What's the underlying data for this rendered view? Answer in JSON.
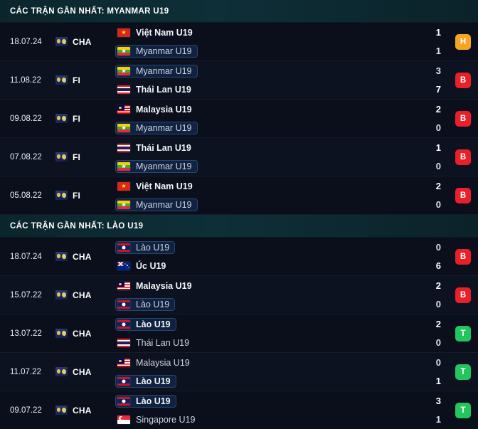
{
  "sections": [
    {
      "title": "CÁC TRẬN GẦN NHẤT: MYANMAR U19",
      "matches": [
        {
          "date": "18.07.24",
          "competition": "CHA",
          "competition_icon": "world-cup-qualifier-icon",
          "home": {
            "name": "Việt Nam U19",
            "flag": "vn",
            "score": "1",
            "bold": true,
            "highlight": false
          },
          "away": {
            "name": "Myanmar U19",
            "flag": "mm",
            "score": "1",
            "bold": false,
            "highlight": true
          },
          "result": {
            "label": "H",
            "color": "#f5a524"
          }
        },
        {
          "date": "11.08.22",
          "competition": "FI",
          "competition_icon": "world-cup-qualifier-icon",
          "home": {
            "name": "Myanmar U19",
            "flag": "mm",
            "score": "3",
            "bold": false,
            "highlight": true
          },
          "away": {
            "name": "Thái Lan U19",
            "flag": "th",
            "score": "7",
            "bold": true,
            "highlight": false
          },
          "result": {
            "label": "B",
            "color": "#e8202a"
          }
        },
        {
          "date": "09.08.22",
          "competition": "FI",
          "competition_icon": "world-cup-qualifier-icon",
          "home": {
            "name": "Malaysia U19",
            "flag": "my",
            "score": "2",
            "bold": true,
            "highlight": false
          },
          "away": {
            "name": "Myanmar U19",
            "flag": "mm",
            "score": "0",
            "bold": false,
            "highlight": true
          },
          "result": {
            "label": "B",
            "color": "#e8202a"
          }
        },
        {
          "date": "07.08.22",
          "competition": "FI",
          "competition_icon": "world-cup-qualifier-icon",
          "home": {
            "name": "Thái Lan U19",
            "flag": "th",
            "score": "1",
            "bold": true,
            "highlight": false
          },
          "away": {
            "name": "Myanmar U19",
            "flag": "mm",
            "score": "0",
            "bold": false,
            "highlight": true
          },
          "result": {
            "label": "B",
            "color": "#e8202a"
          }
        },
        {
          "date": "05.08.22",
          "competition": "FI",
          "competition_icon": "world-cup-qualifier-icon",
          "home": {
            "name": "Việt Nam U19",
            "flag": "vn",
            "score": "2",
            "bold": true,
            "highlight": false
          },
          "away": {
            "name": "Myanmar U19",
            "flag": "mm",
            "score": "0",
            "bold": false,
            "highlight": true
          },
          "result": {
            "label": "B",
            "color": "#e8202a"
          }
        }
      ]
    },
    {
      "title": "CÁC TRẬN GẦN NHẤT: LÀO U19",
      "matches": [
        {
          "date": "18.07.24",
          "competition": "CHA",
          "competition_icon": "world-cup-qualifier-icon",
          "home": {
            "name": "Lào U19",
            "flag": "la",
            "score": "0",
            "bold": false,
            "highlight": true
          },
          "away": {
            "name": "Úc U19",
            "flag": "au",
            "score": "6",
            "bold": true,
            "highlight": false
          },
          "result": {
            "label": "B",
            "color": "#e8202a"
          }
        },
        {
          "date": "15.07.22",
          "competition": "CHA",
          "competition_icon": "world-cup-qualifier-icon",
          "home": {
            "name": "Malaysia U19",
            "flag": "my",
            "score": "2",
            "bold": true,
            "highlight": false
          },
          "away": {
            "name": "Lào U19",
            "flag": "la",
            "score": "0",
            "bold": false,
            "highlight": true
          },
          "result": {
            "label": "B",
            "color": "#e8202a"
          }
        },
        {
          "date": "13.07.22",
          "competition": "CHA",
          "competition_icon": "world-cup-qualifier-icon",
          "home": {
            "name": "Lào U19",
            "flag": "la",
            "score": "2",
            "bold": true,
            "highlight": true
          },
          "away": {
            "name": "Thái Lan U19",
            "flag": "th",
            "score": "0",
            "bold": false,
            "highlight": false
          },
          "result": {
            "label": "T",
            "color": "#22c55e"
          }
        },
        {
          "date": "11.07.22",
          "competition": "CHA",
          "competition_icon": "world-cup-qualifier-icon",
          "home": {
            "name": "Malaysia U19",
            "flag": "my",
            "score": "0",
            "bold": false,
            "highlight": false
          },
          "away": {
            "name": "Lào U19",
            "flag": "la",
            "score": "1",
            "bold": true,
            "highlight": true
          },
          "result": {
            "label": "T",
            "color": "#22c55e"
          }
        },
        {
          "date": "09.07.22",
          "competition": "CHA",
          "competition_icon": "world-cup-qualifier-icon",
          "home": {
            "name": "Lào U19",
            "flag": "la",
            "score": "3",
            "bold": true,
            "highlight": true
          },
          "away": {
            "name": "Singapore U19",
            "flag": "sg",
            "score": "1",
            "bold": false,
            "highlight": false
          },
          "result": {
            "label": "T",
            "color": "#22c55e"
          }
        }
      ]
    }
  ]
}
